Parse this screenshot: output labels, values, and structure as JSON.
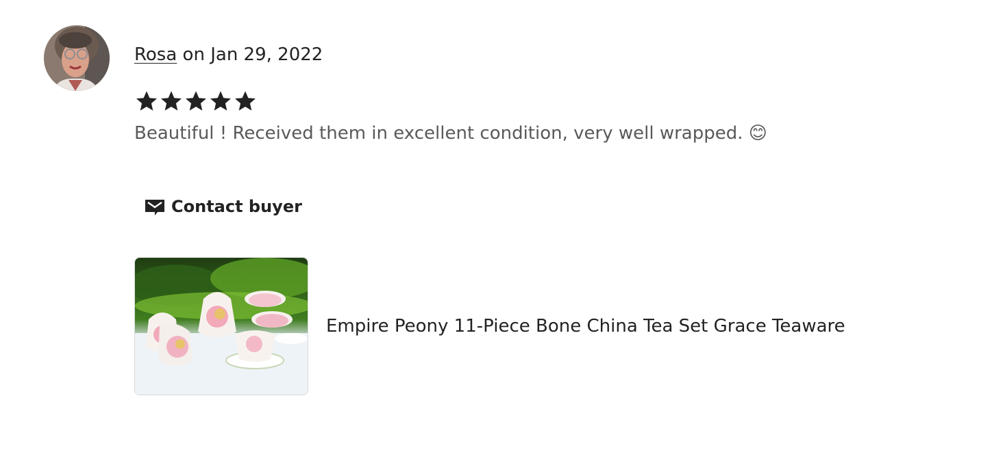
{
  "review": {
    "reviewer_name": "Rosa",
    "date_text": " on Jan 29, 2022",
    "rating": 5,
    "rating_max": 5,
    "text": "Beautiful ! Received them in excellent condition, very well wrapped. 😊"
  },
  "actions": {
    "contact_label": "Contact buyer",
    "contact_icon": "envelope-icon"
  },
  "product": {
    "title": "Empire Peony 11-Piece Bone China Tea Set Grace Teaware"
  },
  "colors": {
    "text_primary": "#222222",
    "text_secondary": "#595959",
    "star": "#222222"
  }
}
